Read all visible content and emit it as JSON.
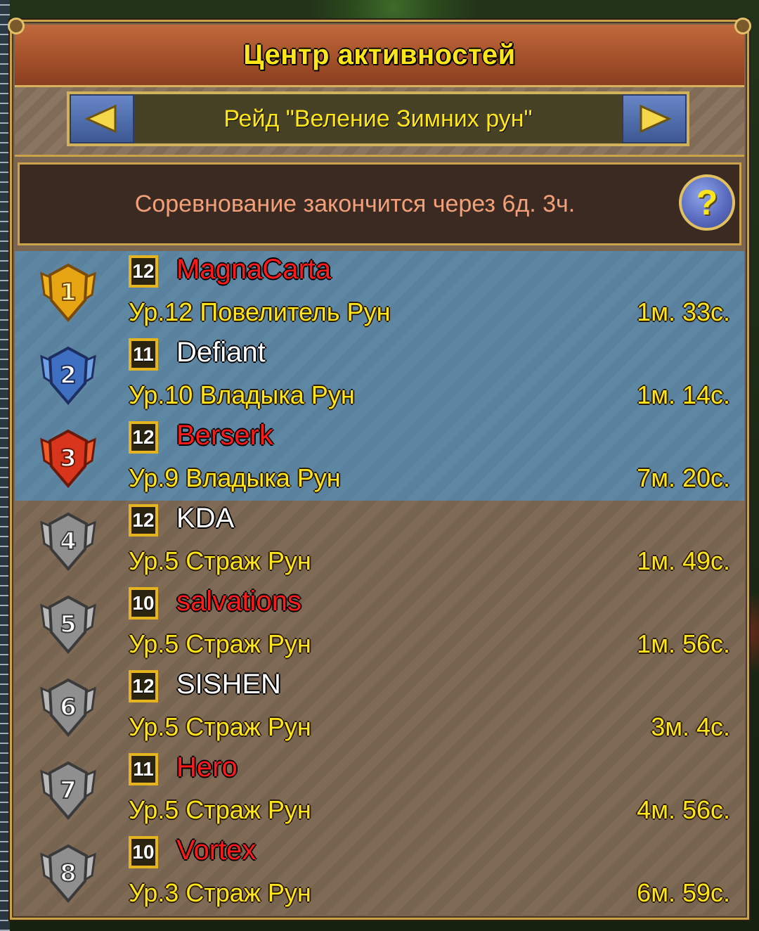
{
  "window": {
    "title": "Центр активностей"
  },
  "selector": {
    "label": "Рейд \"Веление Зимних рун\""
  },
  "info": {
    "countdown": "Соревнование закончится через 6д. 3ч.",
    "help_symbol": "?"
  },
  "colors": {
    "title_yellow": "#ffe619",
    "name_red": "#ff1a1a",
    "top3_bg": "#5e87a4",
    "rest_bg": "#7e6a55",
    "info_text": "#f2a07a"
  },
  "leaderboard": [
    {
      "rank": "1",
      "level": "12",
      "name": "MagnaCarta",
      "name_color": "red",
      "rank_title": "Ур.12 Повелитель Рун",
      "time": "1м. 33с."
    },
    {
      "rank": "2",
      "level": "11",
      "name": "Defiant",
      "name_color": "white",
      "rank_title": "Ур.10 Владыка Рун",
      "time": "1м. 14с."
    },
    {
      "rank": "3",
      "level": "12",
      "name": "Berserk",
      "name_color": "red",
      "rank_title": "Ур.9 Владыка Рун",
      "time": "7м. 20с."
    },
    {
      "rank": "4",
      "level": "12",
      "name": "KDA",
      "name_color": "white",
      "rank_title": "Ур.5 Страж Рун",
      "time": "1м. 49с."
    },
    {
      "rank": "5",
      "level": "10",
      "name": "salvations",
      "name_color": "red",
      "rank_title": "Ур.5 Страж Рун",
      "time": "1м. 56с."
    },
    {
      "rank": "6",
      "level": "12",
      "name": "SISHEN",
      "name_color": "white",
      "rank_title": "Ур.5 Страж Рун",
      "time": "3м. 4с."
    },
    {
      "rank": "7",
      "level": "11",
      "name": "Hero",
      "name_color": "red",
      "rank_title": "Ур.5 Страж Рун",
      "time": "4м. 56с."
    },
    {
      "rank": "8",
      "level": "10",
      "name": "Vortex",
      "name_color": "red",
      "rank_title": "Ур.3 Страж Рун",
      "time": "6м. 59с."
    }
  ]
}
